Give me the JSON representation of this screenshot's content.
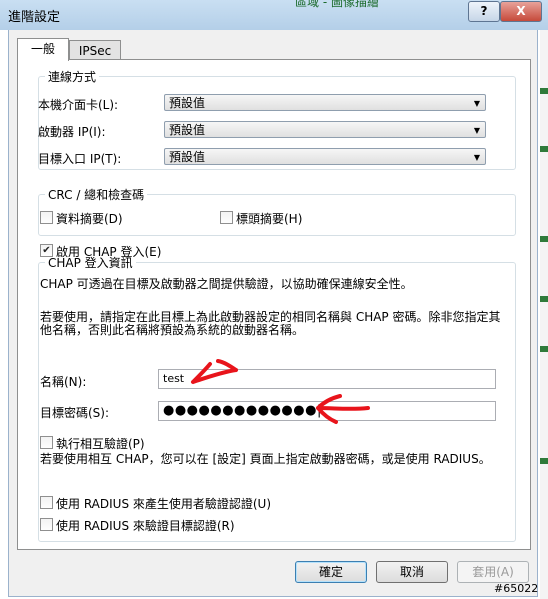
{
  "window": {
    "title": "進階設定",
    "help_label": "?",
    "close_label": "X",
    "background_text": "區域 - 圖像描繪"
  },
  "tabs": [
    {
      "label": "一般",
      "selected": true
    },
    {
      "label": "IPSec",
      "selected": false
    }
  ],
  "connection": {
    "legend": "連線方式",
    "local_adapter_label": "本機介面卡(L):",
    "local_adapter_value": "預設值",
    "initiator_ip_label": "啟動器 IP(I):",
    "initiator_ip_value": "預設值",
    "target_portal_label": "目標入口 IP(T):",
    "target_portal_value": "預設值"
  },
  "crc": {
    "legend": "CRC / 總和檢查碼",
    "data_digest_label": "資料摘要(D)",
    "data_digest_checked": false,
    "header_digest_label": "標頭摘要(H)",
    "header_digest_checked": false
  },
  "chap": {
    "enable_label": "啟用 CHAP 登入(E)",
    "enable_checked": true,
    "legend": "CHAP 登入資訊",
    "desc1": "CHAP 可透過在目標及啟動器之間提供驗證，以協助確保連線安全性。",
    "desc2": "若要使用，請指定在此目標上為此啟動器設定的相同名稱與 CHAP 密碼。除非您指定其他名稱，否則此名稱將預設為系統的啟動器名稱。",
    "name_label": "名稱(N):",
    "name_value": "test",
    "secret_label": "目標密碼(S):",
    "secret_value": "●●●●●●●●●●●●●",
    "mutual_label": "執行相互驗證(P)",
    "mutual_checked": false,
    "mutual_desc": "若要使用相互 CHAP，您可以在 [設定] 頁面上指定啟動器密碼，或是使用 RADIUS。"
  },
  "radius": {
    "generate_label": "使用 RADIUS 來產生使用者驗證認證(U)",
    "generate_checked": false,
    "authenticate_label": "使用 RADIUS 來驗證目標認證(R)",
    "authenticate_checked": false
  },
  "buttons": {
    "ok": "確定",
    "cancel": "取消",
    "apply": "套用(A)"
  },
  "watermark": "#65022",
  "colors": {
    "annotation": "#e8141b",
    "title_bar": "#b9d3ec"
  }
}
